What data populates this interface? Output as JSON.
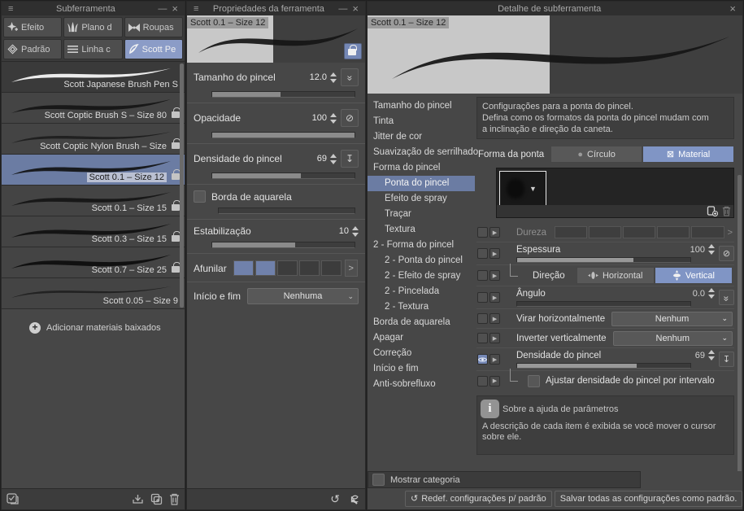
{
  "colors": {
    "panel_bg": "#474747",
    "titlebar_bg": "#2f2f2f",
    "selection_blue": "#6b7ca3",
    "accent_blue": "#8095c5",
    "preview_light": "#c8c8c8"
  },
  "icons": {
    "menu": "≡",
    "minimize": "—",
    "close": "×",
    "slash": "⊘",
    "down_to_bar": "↧",
    "reset": "↺",
    "double_chevron": "»",
    "play": "▶",
    "dropdown": "▼",
    "chevron_right": ">",
    "chevron_down": "⌄",
    "circle": "●",
    "material": "⊠",
    "plus": "+",
    "lines": "≡"
  },
  "subtool_panel": {
    "title": "Subferramenta",
    "tabs": [
      {
        "label": "Efeito",
        "icon": "sparkle-icon"
      },
      {
        "label": "Plano d",
        "icon": "grass-icon"
      },
      {
        "label": "Roupas",
        "icon": "ribbon-icon"
      },
      {
        "label": "Padrão",
        "icon": "pattern-icon"
      },
      {
        "label": "Linha c",
        "icon": "lines-icon"
      },
      {
        "label": "Scott Pe",
        "icon": "pen-icon",
        "selected": true
      }
    ],
    "brushes": [
      {
        "name": "Scott Japanese Brush Pen S",
        "locked": false,
        "selected": false
      },
      {
        "name": "Scott Coptic Brush S – Size 80",
        "locked": true,
        "selected": false
      },
      {
        "name": "Scott Coptic Nylon Brush – Size",
        "locked": true,
        "selected": false
      },
      {
        "name": "Scott 0.1 – Size 12",
        "locked": true,
        "selected": true
      },
      {
        "name": "Scott 0.1 – Size 15",
        "locked": true,
        "selected": false
      },
      {
        "name": "Scott 0.3 – Size 15",
        "locked": true,
        "selected": false
      },
      {
        "name": "Scott 0.7 – Size 25",
        "locked": true,
        "selected": false
      },
      {
        "name": "Scott 0.05 – Size 9",
        "locked": false,
        "selected": false
      }
    ],
    "add_materials": "Adicionar materiais baixados"
  },
  "tool_properties_panel": {
    "title": "Propriedades da ferramenta",
    "preview_label": "Scott 0.1 – Size 12",
    "brush_size": {
      "label": "Tamanho do pincel",
      "value": "12.0"
    },
    "opacity": {
      "label": "Opacidade",
      "value": "100"
    },
    "brush_density": {
      "label": "Densidade do pincel",
      "value": "69"
    },
    "watercolor_edge": {
      "label": "Borda de aquarela",
      "checked": false
    },
    "stabilization": {
      "label": "Estabilização",
      "value": "10"
    },
    "taper": {
      "label": "Afunilar",
      "segments_filled": 2,
      "segments_total": 5
    },
    "start_end": {
      "label": "Início e fim",
      "value": "Nenhuma"
    }
  },
  "detail_panel": {
    "title": "Detalhe de subferramenta",
    "preview_label": "Scott 0.1 – Size 12",
    "categories": [
      {
        "label": "Tamanho do pincel",
        "indent": 0
      },
      {
        "label": "Tinta",
        "indent": 0
      },
      {
        "label": "Jitter de cor",
        "indent": 0
      },
      {
        "label": "Suavização de serrilhado",
        "indent": 0
      },
      {
        "label": "Forma do pincel",
        "indent": 0
      },
      {
        "label": "Ponta do pincel",
        "indent": 1,
        "selected": true
      },
      {
        "label": "Efeito de spray",
        "indent": 1
      },
      {
        "label": "Traçar",
        "indent": 1
      },
      {
        "label": "Textura",
        "indent": 1
      },
      {
        "label": "2 - Forma do pincel",
        "indent": 0
      },
      {
        "label": "2 - Ponta do pincel",
        "indent": 1
      },
      {
        "label": "2 - Efeito de spray",
        "indent": 1
      },
      {
        "label": "2 - Pincelada",
        "indent": 1
      },
      {
        "label": "2 - Textura",
        "indent": 1
      },
      {
        "label": "Borda de aquarela",
        "indent": 0
      },
      {
        "label": "Apagar",
        "indent": 0
      },
      {
        "label": "Correção",
        "indent": 0
      },
      {
        "label": "Início e fim",
        "indent": 0
      },
      {
        "label": "Anti-sobrefluxo",
        "indent": 0
      }
    ],
    "description": {
      "line1": "Configurações para a ponta do pincel.",
      "line2": "Defina como os formatos da ponta do pincel mudam com",
      "line3": "a inclinação e direção da caneta."
    },
    "tip_shape": {
      "label": "Forma da ponta",
      "circle": "Círculo",
      "material": "Material",
      "selected": "Material"
    },
    "hardness": {
      "label": "Dureza",
      "segments_filled": 0,
      "segments_total": 5
    },
    "thickness": {
      "label": "Espessura",
      "value": "100"
    },
    "direction": {
      "label": "Direção",
      "horizontal": "Horizontal",
      "vertical": "Vertical",
      "selected": "Vertical"
    },
    "angle": {
      "label": "Ângulo",
      "value": "0.0"
    },
    "flip_horizontal": {
      "label": "Virar horizontalmente",
      "value": "Nenhum"
    },
    "flip_vertical": {
      "label": "Inverter verticalmente",
      "value": "Nenhum"
    },
    "brush_density": {
      "label": "Densidade do pincel",
      "value": "69"
    },
    "adjust_density": {
      "label": "Ajustar densidade do pincel por intervalo",
      "checked": false
    },
    "help": {
      "title": "Sobre a ajuda de parâmetros",
      "text": "A descrição de cada item é exibida se você mover o cursor sobre ele."
    },
    "show_category": {
      "label": "Mostrar categoria",
      "checked": false
    },
    "reset_button": "Redef. configurações p/ padrão",
    "save_button": "Salvar todas as configurações como padrão."
  }
}
